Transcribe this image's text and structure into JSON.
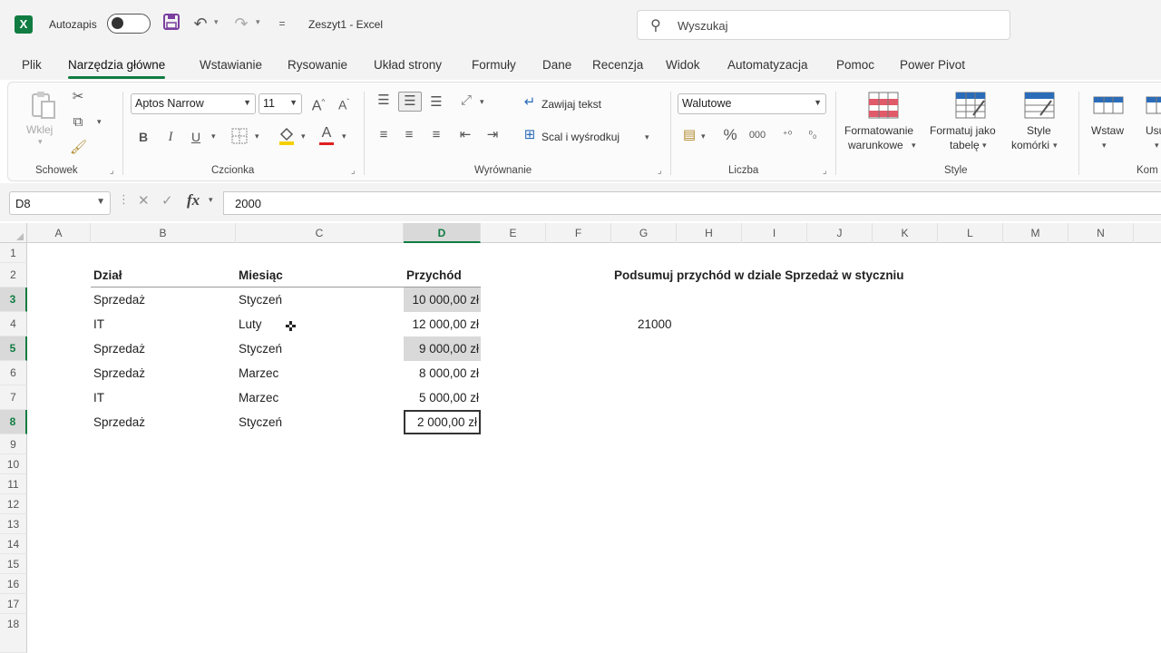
{
  "titlebar": {
    "logo_letter": "X",
    "autosave_label": "Autozapis",
    "qat_more": "=",
    "document_title": "Zeszyt1  -  Excel",
    "search_placeholder": "Wyszukaj",
    "icons": [
      "excel-logo",
      "save-icon",
      "undo-icon",
      "redo-icon"
    ]
  },
  "tabs": [
    {
      "label": "Plik"
    },
    {
      "label": "Narzędzia główne",
      "active": true
    },
    {
      "label": "Wstawianie"
    },
    {
      "label": "Rysowanie"
    },
    {
      "label": "Układ strony"
    },
    {
      "label": "Formuły"
    },
    {
      "label": "Dane"
    },
    {
      "label": "Recenzja"
    },
    {
      "label": "Widok"
    },
    {
      "label": "Automatyzacja"
    },
    {
      "label": "Pomoc"
    },
    {
      "label": "Power Pivot"
    }
  ],
  "ribbon": {
    "clipboard": {
      "group_label": "Schowek",
      "paste_label": "Wklej"
    },
    "font": {
      "group_label": "Czcionka",
      "font_name": "Aptos Narrow",
      "font_size": "11",
      "grow_label": "A",
      "shrink_label": "A",
      "bold": "B",
      "italic": "I",
      "underline": "U",
      "font_color_letter": "A",
      "fill_color": "#f5d000",
      "font_color": "#e02020"
    },
    "alignment": {
      "group_label": "Wyrównanie",
      "wrap_text": "Zawijaj tekst",
      "merge_center": "Scal i wyśrodkuj"
    },
    "number": {
      "group_label": "Liczba",
      "format": "Walutowe",
      "percent": "%",
      "thousands": "000"
    },
    "styles": {
      "group_label": "Style",
      "conditional_1": "Formatowanie",
      "conditional_2": "warunkowe",
      "format_table_1": "Formatuj jako",
      "format_table_2": "tabelę",
      "cell_styles_1": "Style",
      "cell_styles_2": "komórki"
    },
    "cells": {
      "insert_label": "Wstaw",
      "delete_label": "Usu",
      "group_label": "Kom"
    }
  },
  "formula_bar": {
    "name_box": "D8",
    "cancel": "✕",
    "confirm": "✓",
    "fx": "fx",
    "formula": "2000"
  },
  "grid": {
    "columns": [
      "A",
      "B",
      "C",
      "D",
      "E",
      "F",
      "G",
      "H",
      "I",
      "J",
      "K",
      "L",
      "M",
      "N"
    ],
    "selected_column": "D",
    "rows": [
      "1",
      "2",
      "3",
      "4",
      "5",
      "6",
      "7",
      "8",
      "9",
      "10",
      "11",
      "12",
      "13",
      "14",
      "15",
      "16",
      "17",
      "18"
    ],
    "table_headers": {
      "dzial": "Dział",
      "miesiac": "Miesiąc",
      "przychod": "Przychód"
    },
    "table_rows": [
      {
        "dzial": "Sprzedaż",
        "miesiac": "Styczeń",
        "przychod": "10 000,00 zł"
      },
      {
        "dzial": "IT",
        "miesiac": "Luty",
        "przychod": "12 000,00 zł"
      },
      {
        "dzial": "Sprzedaż",
        "miesiac": "Styczeń",
        "przychod": "9 000,00 zł"
      },
      {
        "dzial": "Sprzedaż",
        "miesiac": "Marzec",
        "przychod": "8 000,00 zł"
      },
      {
        "dzial": "IT",
        "miesiac": "Marzec",
        "przychod": "5 000,00 zł"
      },
      {
        "dzial": "Sprzedaż",
        "miesiac": "Styczeń",
        "przychod": "2 000,00 zł"
      }
    ],
    "question": "Podsumuj przychód w dziale Sprzedaż w styczniu",
    "result": "21000"
  },
  "colors": {
    "accent": "#107c41",
    "highlight": "#d9d9d9"
  }
}
